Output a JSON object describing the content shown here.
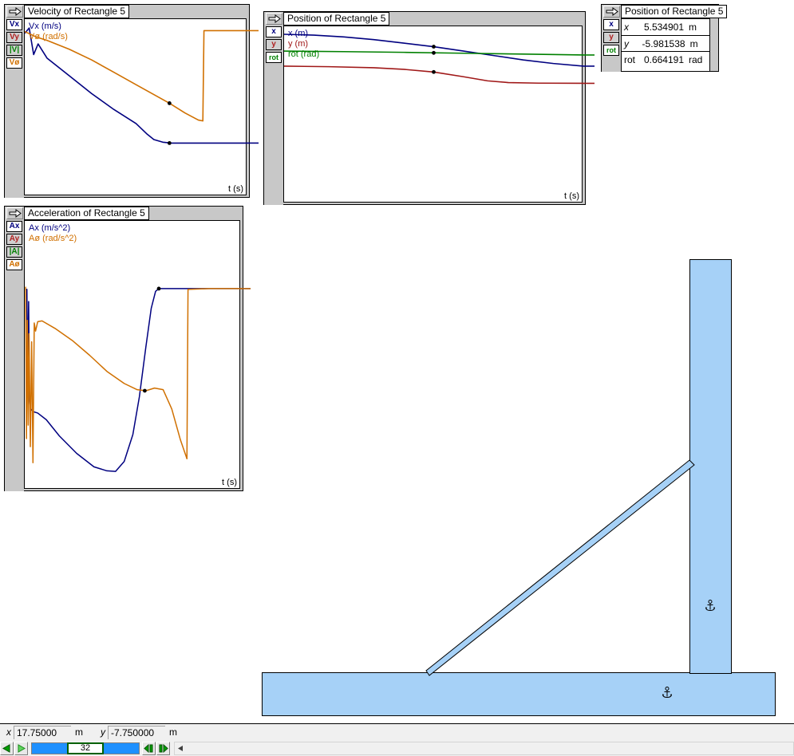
{
  "app": {
    "background_color": "#ffffff",
    "body_fill_color": "#a6d1f7",
    "body_stroke_color": "#000000"
  },
  "windows": {
    "velocity": {
      "title": "Velocity of Rectangle 5",
      "arrow_icon": "right-arrow-icon",
      "side_buttons": [
        {
          "label": "Vx",
          "color": "#000080",
          "name": "vx"
        },
        {
          "label": "Vy",
          "color": "#b02020",
          "name": "vy"
        },
        {
          "label": "|V|",
          "color": "#008000",
          "name": "vmag"
        },
        {
          "label": "Vø",
          "color": "#d07000",
          "name": "vrot"
        }
      ],
      "legend": [
        {
          "label": "Vx (m/s)",
          "color": "#000080"
        },
        {
          "label": "Vø (rad/s)",
          "color": "#d07000"
        }
      ],
      "x_axis_label": "t (s)"
    },
    "position": {
      "title": "Position of Rectangle 5",
      "arrow_icon": "right-arrow-icon",
      "side_buttons": [
        {
          "label": "x",
          "color": "#000080",
          "name": "x"
        },
        {
          "label": "y",
          "color": "#b02020",
          "name": "y"
        },
        {
          "label": "rot",
          "color": "#008000",
          "name": "rot"
        }
      ],
      "legend": [
        {
          "label": "x (m)",
          "color": "#000080"
        },
        {
          "label": "y (m)",
          "color": "#a01818"
        },
        {
          "label": "rot (rad)",
          "color": "#008000"
        }
      ],
      "x_axis_label": "t (s)"
    },
    "acceleration": {
      "title": "Acceleration of Rectangle 5",
      "arrow_icon": "right-arrow-icon",
      "side_buttons": [
        {
          "label": "Ax",
          "color": "#000080",
          "name": "ax"
        },
        {
          "label": "Ay",
          "color": "#b02020",
          "name": "ay"
        },
        {
          "label": "|A|",
          "color": "#008000",
          "name": "amag"
        },
        {
          "label": "Aø",
          "color": "#d07000",
          "name": "arot"
        }
      ],
      "legend": [
        {
          "label": "Ax (m/s^2)",
          "color": "#000080"
        },
        {
          "label": "Aø (rad/s^2)",
          "color": "#d07000"
        }
      ],
      "x_axis_label": "t (s)"
    },
    "position_meter": {
      "title": "Position of Rectangle 5",
      "arrow_icon": "right-arrow-icon",
      "side_buttons": [
        {
          "label": "x",
          "color": "#000080",
          "name": "x"
        },
        {
          "label": "y",
          "color": "#b02020",
          "name": "y"
        },
        {
          "label": "rot",
          "color": "#008000",
          "name": "rot"
        }
      ],
      "rows": [
        {
          "name": "x",
          "value": "5.534901",
          "unit": "m"
        },
        {
          "name": "y",
          "value": "-5.981538",
          "unit": "m"
        },
        {
          "name": "rot",
          "value": "0.664191",
          "unit": "rad"
        }
      ]
    }
  },
  "simulation": {
    "bodies": [
      {
        "name": "ground-platform",
        "kind": "rectangle"
      },
      {
        "name": "vertical-wall",
        "kind": "rectangle"
      },
      {
        "name": "leaning-rod",
        "kind": "thin-rectangle"
      }
    ],
    "anchors": [
      {
        "name": "anchor-wall",
        "icon": "anchor-icon"
      },
      {
        "name": "anchor-ground",
        "icon": "anchor-icon"
      }
    ]
  },
  "statusbar": {
    "x_label": "x",
    "x_value": "17.75000",
    "x_unit": "m",
    "y_label": "y",
    "y_value": "-7.750000",
    "y_unit": "m",
    "frame": "32",
    "controls": [
      {
        "name": "reset-button",
        "icon": "left-triangle-icon",
        "color": "#00a000"
      },
      {
        "name": "run-button",
        "icon": "right-triangle-icon",
        "color": "#40c040"
      },
      {
        "name": "step-back-button",
        "icon": "step-back-icon",
        "color": "#00a000"
      },
      {
        "name": "step-forward-button",
        "icon": "step-forward-icon",
        "color": "#00a000"
      }
    ],
    "scroll_left_icon": "left-arrow-icon"
  },
  "chart_data": [
    {
      "type": "line",
      "title": "Velocity of Rectangle 5",
      "xlabel": "t (s)",
      "ylabel": "",
      "grid": false,
      "legend_position": "top-left",
      "series": [
        {
          "name": "Vx (m/s)",
          "color": "#000080",
          "unit": "m/s",
          "points": [
            [
              0.0,
              0.92
            ],
            [
              0.02,
              0.95
            ],
            [
              0.04,
              0.8
            ],
            [
              0.06,
              0.86
            ],
            [
              0.1,
              0.78
            ],
            [
              0.2,
              0.68
            ],
            [
              0.3,
              0.58
            ],
            [
              0.4,
              0.49
            ],
            [
              0.5,
              0.41
            ],
            [
              0.55,
              0.35
            ],
            [
              0.58,
              0.32
            ],
            [
              0.62,
              0.305
            ],
            [
              0.66,
              0.3
            ],
            [
              1.0,
              0.3
            ]
          ],
          "marker_point": [
            0.65,
            0.3
          ]
        },
        {
          "name": "Vø (rad/s)",
          "color": "#d07000",
          "unit": "rad/s",
          "points": [
            [
              0.0,
              0.93
            ],
            [
              0.05,
              0.9
            ],
            [
              0.1,
              0.88
            ],
            [
              0.2,
              0.83
            ],
            [
              0.3,
              0.77
            ],
            [
              0.4,
              0.7
            ],
            [
              0.5,
              0.63
            ],
            [
              0.6,
              0.56
            ],
            [
              0.65,
              0.525
            ],
            [
              0.72,
              0.47
            ],
            [
              0.78,
              0.43
            ],
            [
              0.8,
              0.425
            ],
            [
              0.805,
              0.935
            ],
            [
              1.0,
              0.935
            ]
          ],
          "marker_point": [
            0.65,
            0.525
          ]
        }
      ]
    },
    {
      "type": "line",
      "title": "Position of Rectangle 5",
      "xlabel": "t (s)",
      "ylabel": "",
      "grid": false,
      "legend_position": "top-left",
      "series": [
        {
          "name": "x (m)",
          "color": "#000080",
          "unit": "m",
          "points": [
            [
              0.0,
              0.955
            ],
            [
              0.1,
              0.95
            ],
            [
              0.2,
              0.94
            ],
            [
              0.3,
              0.925
            ],
            [
              0.4,
              0.905
            ],
            [
              0.5,
              0.885
            ],
            [
              0.6,
              0.86
            ],
            [
              0.7,
              0.835
            ],
            [
              0.8,
              0.81
            ],
            [
              0.9,
              0.79
            ],
            [
              1.0,
              0.775
            ]
          ],
          "marker_point": [
            0.5,
            0.885
          ]
        },
        {
          "name": "rot (rad)",
          "color": "#008000",
          "unit": "rad",
          "points": [
            [
              0.0,
              0.86
            ],
            [
              0.2,
              0.857
            ],
            [
              0.4,
              0.853
            ],
            [
              0.6,
              0.848
            ],
            [
              0.8,
              0.843
            ],
            [
              1.0,
              0.838
            ]
          ],
          "marker_point": [
            0.5,
            0.85
          ]
        },
        {
          "name": "y (m)",
          "color": "#a01818",
          "unit": "m",
          "points": [
            [
              0.0,
              0.775
            ],
            [
              0.15,
              0.772
            ],
            [
              0.3,
              0.766
            ],
            [
              0.4,
              0.757
            ],
            [
              0.5,
              0.742
            ],
            [
              0.6,
              0.715
            ],
            [
              0.68,
              0.692
            ],
            [
              0.75,
              0.682
            ],
            [
              0.85,
              0.679
            ],
            [
              1.0,
              0.678
            ]
          ],
          "marker_point": [
            0.5,
            0.742
          ]
        }
      ]
    },
    {
      "type": "line",
      "title": "Acceleration of Rectangle 5",
      "xlabel": "t (s)",
      "ylabel": "",
      "grid": false,
      "legend_position": "top-left",
      "series": [
        {
          "name": "Ax (m/s^2)",
          "color": "#000080",
          "unit": "m/s^2",
          "points": [
            [
              0.005,
              0.745
            ],
            [
              0.01,
              0.745
            ],
            [
              0.013,
              0.4
            ],
            [
              0.018,
              0.7
            ],
            [
              0.022,
              0.33
            ],
            [
              0.028,
              0.3
            ],
            [
              0.034,
              0.295
            ],
            [
              0.04,
              0.29
            ],
            [
              0.06,
              0.285
            ],
            [
              0.1,
              0.26
            ],
            [
              0.16,
              0.2
            ],
            [
              0.24,
              0.135
            ],
            [
              0.32,
              0.085
            ],
            [
              0.38,
              0.07
            ],
            [
              0.42,
              0.068
            ],
            [
              0.46,
              0.105
            ],
            [
              0.5,
              0.205
            ],
            [
              0.53,
              0.345
            ],
            [
              0.56,
              0.53
            ],
            [
              0.585,
              0.675
            ],
            [
              0.605,
              0.738
            ],
            [
              0.62,
              0.748
            ],
            [
              0.8,
              0.748
            ],
            [
              1.0,
              0.748
            ]
          ],
          "marker_point": [
            0.62,
            0.748
          ]
        },
        {
          "name": "Aø (rad/s^2)",
          "color": "#d07000",
          "unit": "rad/s^2",
          "points": [
            [
              0.004,
              0.755
            ],
            [
              0.008,
              0.19
            ],
            [
              0.012,
              0.63
            ],
            [
              0.016,
              0.24
            ],
            [
              0.02,
              0.58
            ],
            [
              0.026,
              0.16
            ],
            [
              0.032,
              0.55
            ],
            [
              0.038,
              0.1
            ],
            [
              0.044,
              0.62
            ],
            [
              0.05,
              0.59
            ],
            [
              0.06,
              0.625
            ],
            [
              0.08,
              0.628
            ],
            [
              0.14,
              0.6
            ],
            [
              0.22,
              0.555
            ],
            [
              0.3,
              0.5
            ],
            [
              0.38,
              0.44
            ],
            [
              0.46,
              0.395
            ],
            [
              0.52,
              0.372
            ],
            [
              0.56,
              0.368
            ],
            [
              0.6,
              0.378
            ],
            [
              0.64,
              0.372
            ],
            [
              0.68,
              0.3
            ],
            [
              0.72,
              0.185
            ],
            [
              0.75,
              0.115
            ],
            [
              0.755,
              0.745
            ],
            [
              0.85,
              0.748
            ],
            [
              1.0,
              0.748
            ]
          ],
          "marker_point": [
            0.555,
            0.368
          ]
        }
      ]
    }
  ]
}
